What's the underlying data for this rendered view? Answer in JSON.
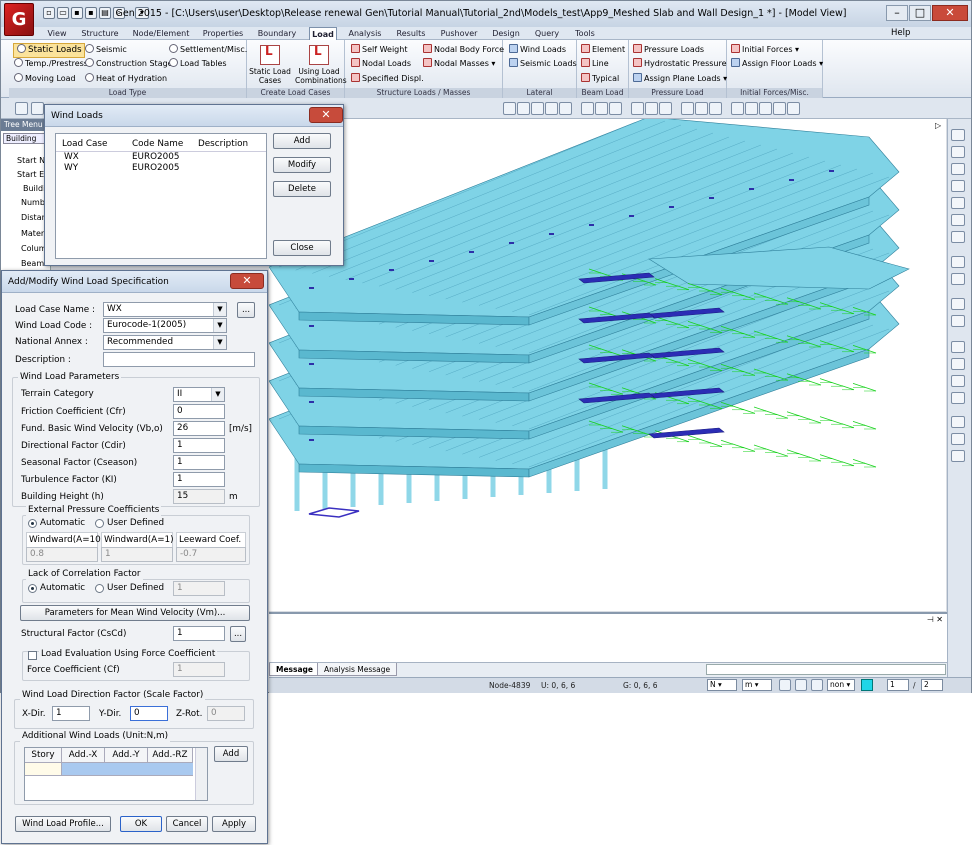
{
  "app": {
    "title": "Gen 2015 - [C:\\Users\\user\\Desktop\\Release renewal Gen\\Tutorial Manual\\Tutorial_2nd\\Models_test\\App9_Meshed Slab and Wall Design_1 *] - [Model View]",
    "logo": "G",
    "help": "Help"
  },
  "menu": [
    "View",
    "Structure",
    "Node/Element",
    "Properties",
    "Boundary",
    "Load",
    "Analysis",
    "Results",
    "Pushover",
    "Design",
    "Query",
    "Tools"
  ],
  "ribbon": {
    "load_type": {
      "label": "Load Type",
      "items": [
        "Static Loads",
        "Seismic",
        "Settlement/Misc.",
        "Temp./Prestress",
        "Construction Stage",
        "Load Tables",
        "Moving Load",
        "Heat of Hydration"
      ]
    },
    "create_cases": {
      "label": "Create Load Cases",
      "items": [
        "Static Load Cases",
        "Using Load Combinations"
      ]
    },
    "structure_loads": {
      "label": "Structure Loads / Masses",
      "items": [
        "Self Weight",
        "Nodal Body Force",
        "Nodal Loads",
        "Nodal Masses",
        "Specified Displ."
      ]
    },
    "lateral": {
      "label": "Lateral",
      "items": [
        "Wind Loads",
        "Seismic Loads"
      ]
    },
    "beam_load": {
      "label": "Beam Load",
      "items": [
        "Element",
        "Line",
        "Typical"
      ]
    },
    "pressure_load": {
      "label": "Pressure Load",
      "items": [
        "Pressure Loads",
        "Hydrostatic Pressure",
        "Assign Plane Loads"
      ]
    },
    "initial": {
      "label": "Initial Forces/Misc.",
      "items": [
        "Initial Forces",
        "Assign Floor Loads"
      ]
    }
  },
  "tree": {
    "header": "Tree Menu",
    "tab": "Building",
    "items": [
      "Start N",
      "Start El",
      "Buildi",
      "Numb",
      "Distan",
      "Materi",
      "Colum",
      "Beam"
    ]
  },
  "wind_loads_dialog": {
    "title": "Wind Loads",
    "columns": [
      "Load Case",
      "Code Name",
      "Description"
    ],
    "rows": [
      [
        "WX",
        "EURO2005",
        ""
      ],
      [
        "WY",
        "EURO2005",
        ""
      ]
    ],
    "buttons": {
      "add": "Add",
      "modify": "Modify",
      "delete": "Delete",
      "close": "Close"
    }
  },
  "spec_dialog": {
    "title": "Add/Modify Wind Load Specification",
    "load_case_name": {
      "label": "Load Case Name :",
      "value": "WX"
    },
    "wind_load_code": {
      "label": "Wind Load Code :",
      "value": "Eurocode-1(2005)"
    },
    "national_annex": {
      "label": "National Annex :",
      "value": "Recommended"
    },
    "description": {
      "label": "Description :",
      "value": ""
    },
    "params_title": "Wind Load Parameters",
    "terrain": {
      "label": "Terrain Category",
      "value": "II"
    },
    "friction": {
      "label": "Friction Coefficient (Cfr)",
      "value": "0"
    },
    "fund_velocity": {
      "label": "Fund. Basic Wind Velocity (Vb,o)",
      "value": "26",
      "unit": "[m/s]"
    },
    "cdir": {
      "label": "Directional Factor (Cdir)",
      "value": "1"
    },
    "cseason": {
      "label": "Seasonal Factor (Cseason)",
      "value": "1"
    },
    "turbulence": {
      "label": "Turbulence Factor (KI)",
      "value": "1"
    },
    "building_height": {
      "label": "Building Height (h)",
      "value": "15",
      "unit": "m"
    },
    "ext_pressure": {
      "title": "External Pressure Coefficients",
      "auto": "Automatic",
      "user": "User Defined",
      "cols": [
        "Windward(A=10)",
        "Windward(A=1)",
        "Leeward Coef."
      ],
      "values": [
        "0.8",
        "1",
        "-0.7"
      ]
    },
    "lack_corr": {
      "title": "Lack of Correlation Factor",
      "auto": "Automatic",
      "user": "User Defined",
      "value": "1"
    },
    "mean_btn": "Parameters for Mean Wind Velocity (Vm)...",
    "struct_factor": {
      "label": "Structural Factor (CsCd)",
      "value": "1"
    },
    "force_eval": {
      "label": "Load Evaluation Using Force Coefficient",
      "coef_label": "Force Coefficient (Cf)",
      "value": "1"
    },
    "direction": {
      "title": "Wind Load Direction Factor (Scale Factor)",
      "x_label": "X-Dir.",
      "x": "1",
      "y_label": "Y-Dir.",
      "y": "0",
      "z_label": "Z-Rot.",
      "z": "0"
    },
    "additional": {
      "title": "Additional Wind Loads (Unit:N,m)",
      "cols": [
        "Story",
        "Add.-X",
        "Add.-Y",
        "Add.-RZ"
      ],
      "add": "Add"
    },
    "buttons": {
      "profile": "Wind Load Profile...",
      "ok": "OK",
      "cancel": "Cancel",
      "apply": "Apply"
    }
  },
  "message_tabs": [
    "Message",
    "Analysis Message"
  ],
  "status": {
    "node": "Node-4839",
    "u": "U: 0, 6, 6",
    "g": "G: 0, 6, 6",
    "force": "N",
    "length": "m",
    "none": "non",
    "page": "1",
    "pages": "2"
  },
  "colors": {
    "structure": "#7fd3e6",
    "load_arrows": "#16d11a",
    "members": "#2d2fa8",
    "load_text": "#20d020"
  }
}
